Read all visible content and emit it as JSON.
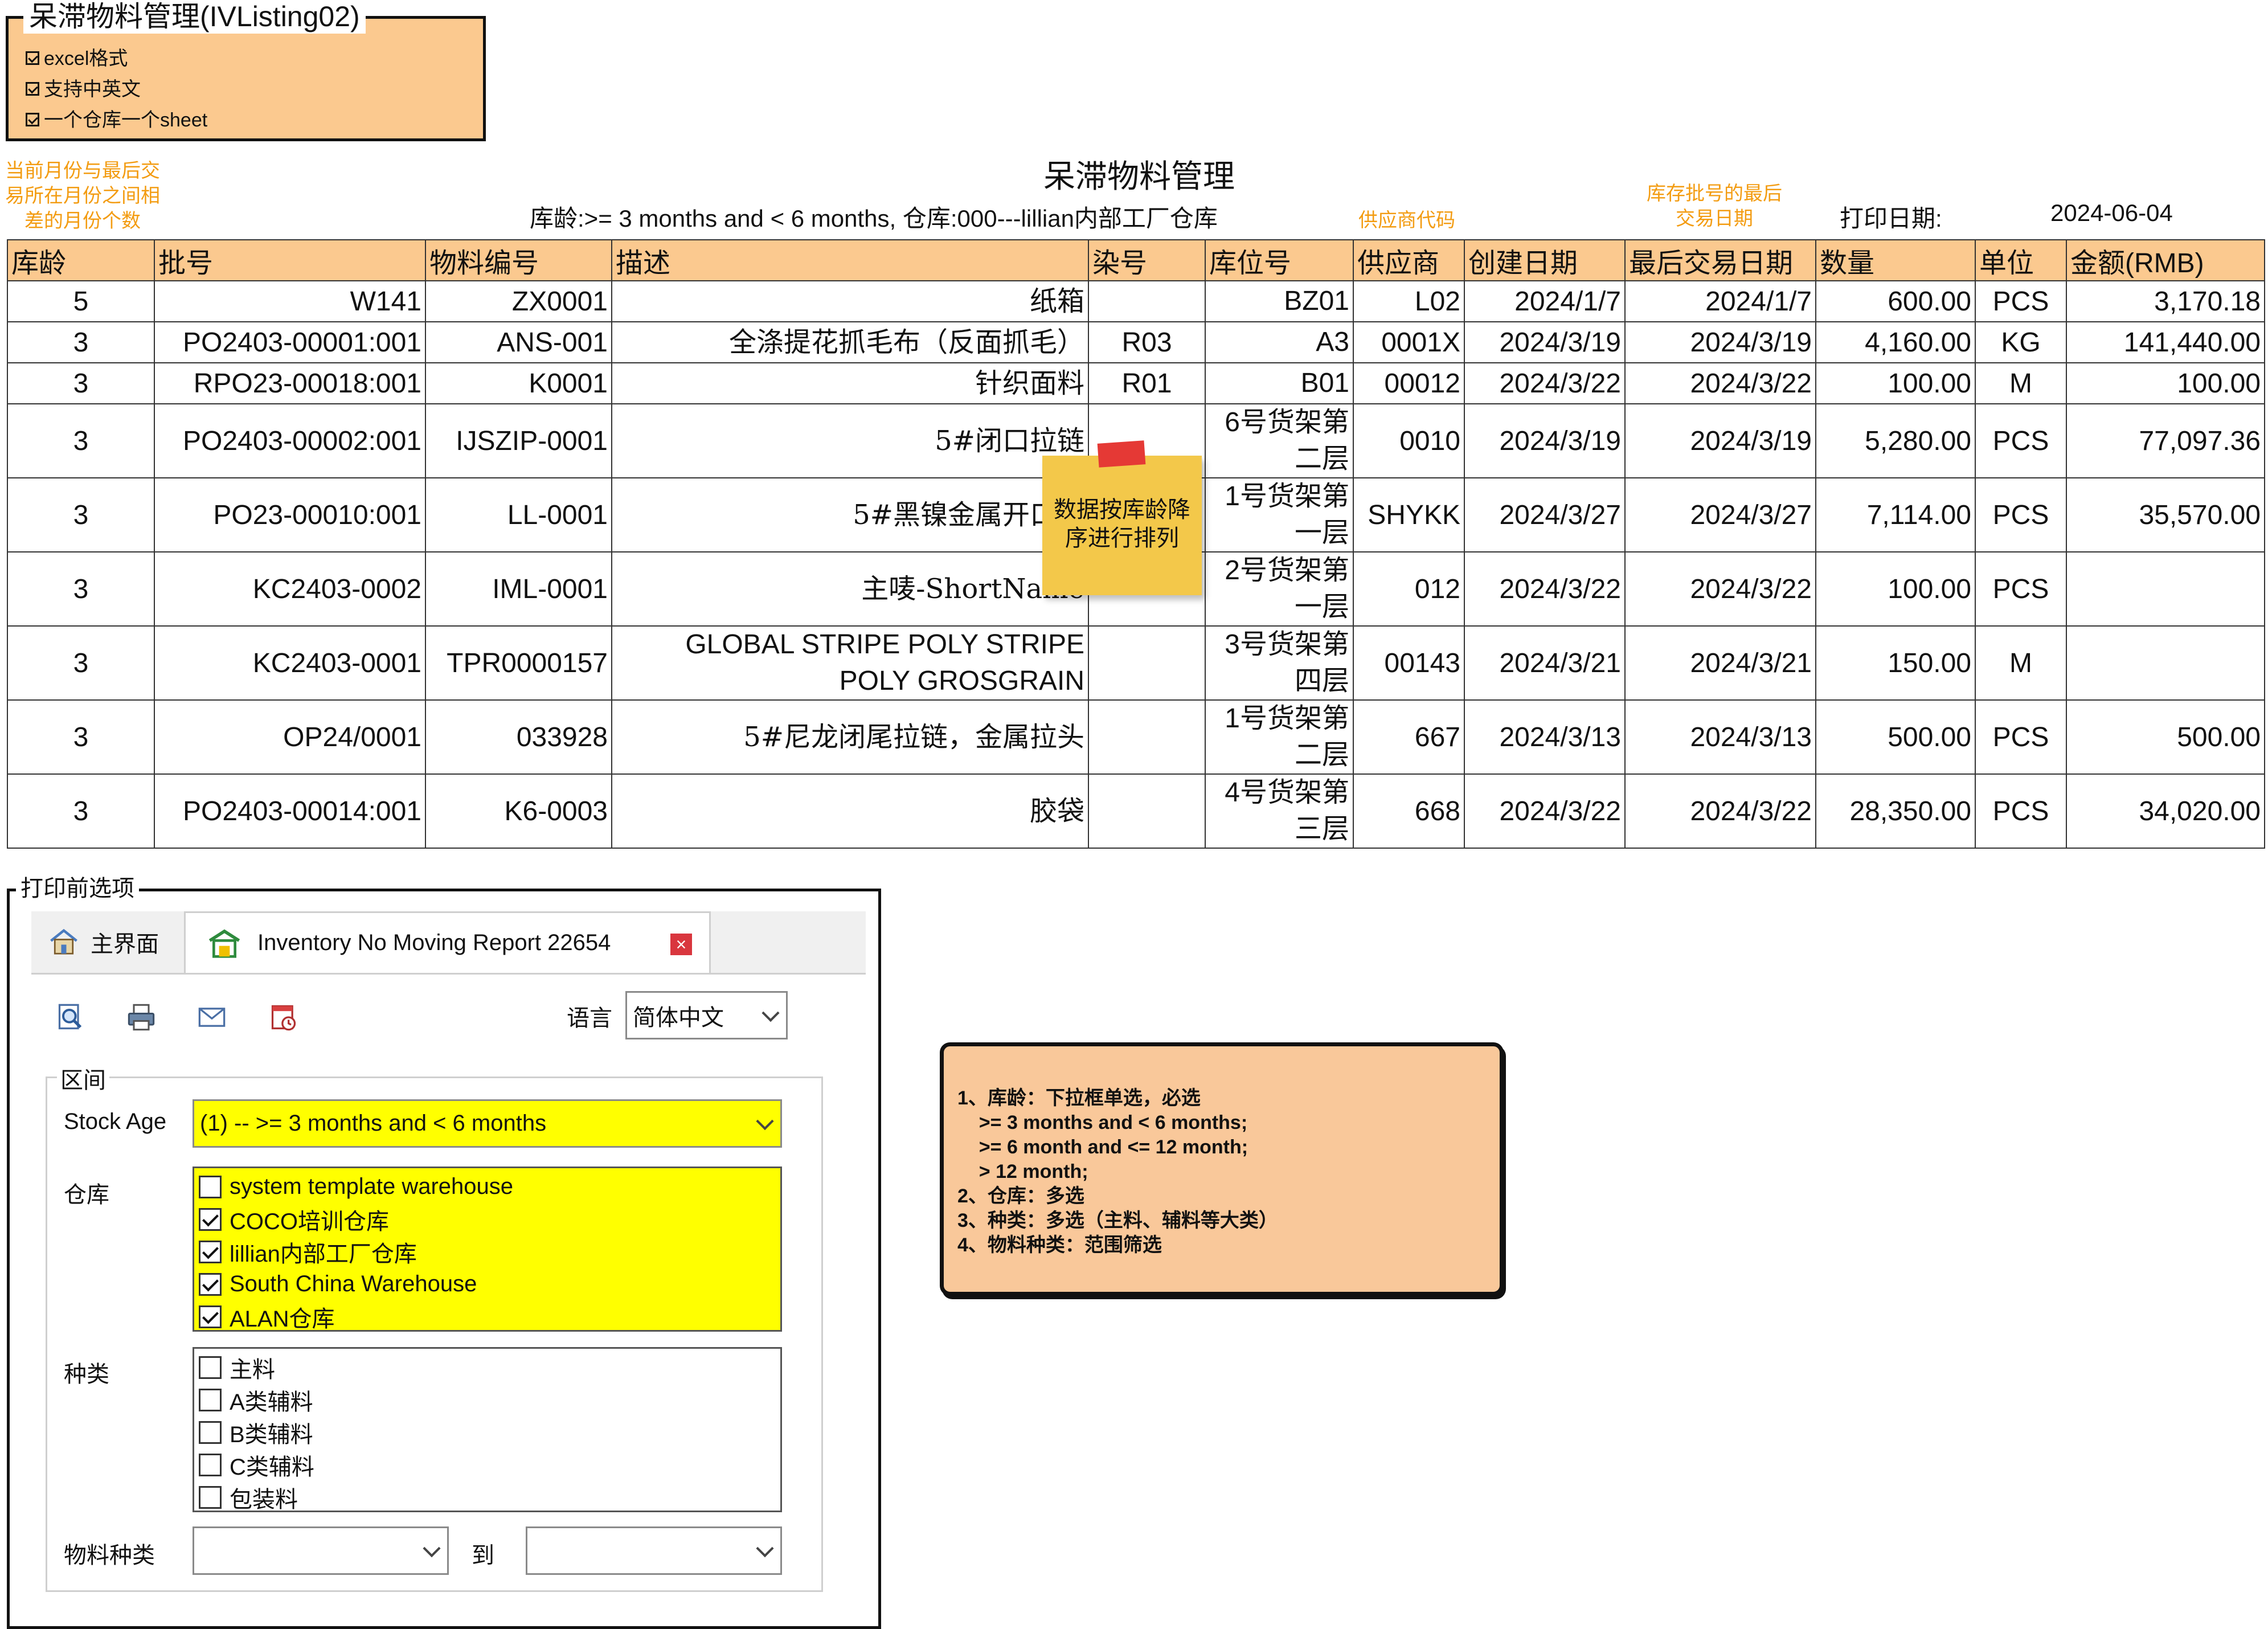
{
  "spec": {
    "title": "呆滞物料管理(IVListing02)",
    "features": [
      "excel格式",
      "支持中英文",
      "一个仓库一个sheet"
    ]
  },
  "notes": {
    "age_note": [
      "当前月份与最后交",
      "易所在月份之间相",
      "差的月份个数"
    ],
    "supplier_note": "供应商代码",
    "last_trans_note": [
      "库存批号的最后",
      "交易日期"
    ],
    "sticky": [
      "数据按库龄降",
      "序进行排列"
    ]
  },
  "report": {
    "title": "呆滞物料管理",
    "subtitle": "库龄:>= 3 months and < 6 months, 仓库:000---lillian内部工厂仓库",
    "print_date_label": "打印日期:",
    "print_date": "2024-06-04",
    "columns": [
      "库龄",
      "批号",
      "物料编号",
      "描述",
      "染号",
      "库位号",
      "供应商",
      "创建日期",
      "最后交易日期",
      "数量",
      "单位",
      "金额(RMB)"
    ],
    "rows": [
      [
        "5",
        "W141",
        "ZX0001",
        "纸箱",
        "",
        "BZ01",
        "L02",
        "2024/1/7",
        "2024/1/7",
        "600.00",
        "PCS",
        "3,170.18"
      ],
      [
        "3",
        "PO2403-00001:001",
        "ANS-001",
        "全涤提花抓毛布（反面抓毛）",
        "R03",
        "A3",
        "0001X",
        "2024/3/19",
        "2024/3/19",
        "4,160.00",
        "KG",
        "141,440.00"
      ],
      [
        "3",
        "RPO23-00018:001",
        "K0001",
        "针织面料",
        "R01",
        "B01",
        "00012",
        "2024/3/22",
        "2024/3/22",
        "100.00",
        "M",
        "100.00"
      ],
      [
        "3",
        "PO2403-00002:001",
        "IJSZIP-0001",
        "5#闭口拉链",
        "",
        "6号货架第二层",
        "0010",
        "2024/3/19",
        "2024/3/19",
        "5,280.00",
        "PCS",
        "77,097.36"
      ],
      [
        "3",
        "PO23-00010:001",
        "LL-0001",
        "5#黑镍金属开口拉",
        "",
        "1号货架第一层",
        "SHYKK",
        "2024/3/27",
        "2024/3/27",
        "7,114.00",
        "PCS",
        "35,570.00"
      ],
      [
        "3",
        "KC2403-0002",
        "IML-0001",
        "主唛-ShortName",
        "",
        "2号货架第一层",
        "012",
        "2024/3/22",
        "2024/3/22",
        "100.00",
        "PCS",
        ""
      ],
      [
        "3",
        "KC2403-0001",
        "TPR0000157",
        "GLOBAL STRIPE POLY STRIPE POLY GROSGRAIN",
        "",
        "3号货架第四层",
        "00143",
        "2024/3/21",
        "2024/3/21",
        "150.00",
        "M",
        ""
      ],
      [
        "3",
        "OP24/0001",
        "033928",
        "5#尼龙闭尾拉链，金属拉头",
        "",
        "1号货架第二层",
        "667",
        "2024/3/13",
        "2024/3/13",
        "500.00",
        "PCS",
        "500.00"
      ],
      [
        "3",
        "PO2403-00014:001",
        "K6-0003",
        "胶袋",
        "",
        "4号货架第三层",
        "668",
        "2024/3/22",
        "2024/3/22",
        "28,350.00",
        "PCS",
        "34,020.00"
      ]
    ]
  },
  "dialog": {
    "legend": "打印前选项",
    "tabs": [
      {
        "label": "主界面",
        "icon": "home-icon"
      },
      {
        "label": "Inventory No Moving Report 22654",
        "icon": "warehouse-icon"
      }
    ],
    "toolbar_icons": [
      "preview-icon",
      "print-icon",
      "email-icon",
      "export-icon"
    ],
    "language_label": "语言",
    "language_value": "简体中文",
    "group_label": "区间",
    "stock_age_label": "Stock Age",
    "stock_age_value": "(1) -- >= 3 months and < 6 months",
    "warehouse_label": "仓库",
    "warehouses": [
      {
        "label": "system template warehouse",
        "checked": false
      },
      {
        "label": "COCO培训仓库",
        "checked": true
      },
      {
        "label": "lillian内部工厂仓库",
        "checked": true
      },
      {
        "label": "South China Warehouse",
        "checked": true
      },
      {
        "label": "ALAN仓库",
        "checked": true
      }
    ],
    "category_label": "种类",
    "categories": [
      {
        "label": "主料",
        "checked": false
      },
      {
        "label": "A类辅料",
        "checked": false
      },
      {
        "label": "B类辅料",
        "checked": false
      },
      {
        "label": "C类辅料",
        "checked": false
      },
      {
        "label": "包装料",
        "checked": false
      }
    ],
    "material_type_label": "物料种类",
    "to_label": "到",
    "highlight_color": "#ffff00"
  },
  "requirements": [
    "1、库龄：下拉框单选，必选",
    "    >= 3 months and < 6 months;",
    "    >= 6 month and <= 12 month;",
    "    > 12 month;",
    "2、仓库：多选",
    "3、种类：多选（主料、辅料等大类）",
    "4、物料种类：范围筛选"
  ]
}
